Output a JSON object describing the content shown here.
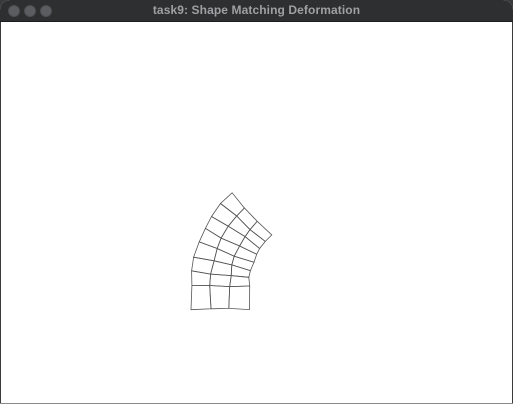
{
  "window": {
    "title": "task9: Shape Matching Deformation"
  },
  "titlebar_buttons": {
    "close": "close-button",
    "minimize": "minimize-button",
    "maximize": "maximize-button"
  },
  "mesh": {
    "columns": 3,
    "rows": 8,
    "line_color": "#555555",
    "background_color": "#ffffff"
  }
}
